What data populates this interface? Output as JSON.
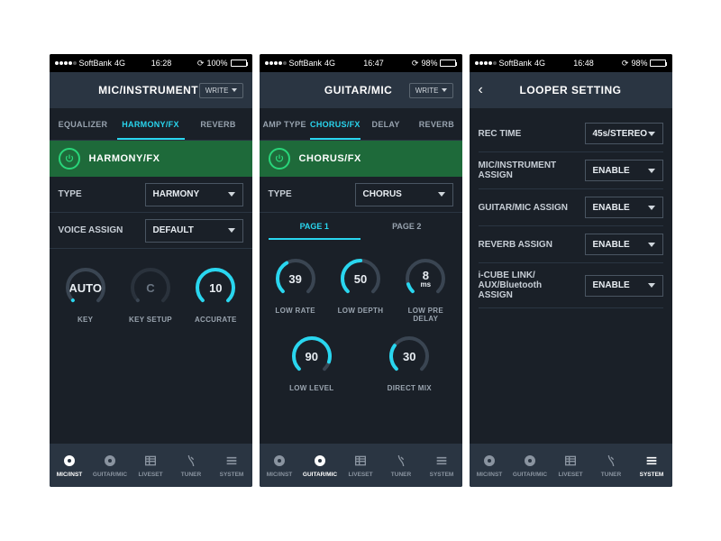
{
  "statusbar": {
    "carrier": "SoftBank",
    "network": "4G",
    "times": [
      "16:28",
      "16:47",
      "16:48"
    ],
    "batteries": [
      "100%",
      "98%",
      "98%"
    ]
  },
  "screens": [
    {
      "title": "MIC/INSTRUMENT",
      "write": "WRITE",
      "tabs": [
        "EQUALIZER",
        "HARMONY/FX",
        "REVERB"
      ],
      "activeTab": 1,
      "fxTitle": "HARMONY/FX",
      "params": [
        {
          "label": "TYPE",
          "value": "HARMONY"
        },
        {
          "label": "VOICE ASSIGN",
          "value": "DEFAULT"
        }
      ],
      "dials": [
        {
          "value": "AUTO",
          "unit": "",
          "caption": "KEY",
          "pct": 0,
          "active": true
        },
        {
          "value": "C",
          "unit": "",
          "caption": "KEY SETUP",
          "pct": 0,
          "active": false
        },
        {
          "value": "10",
          "unit": "",
          "caption": "ACCURATE",
          "pct": 100,
          "active": true
        }
      ],
      "bottomActive": 0
    },
    {
      "title": "GUITAR/MIC",
      "write": "WRITE",
      "tabs": [
        "AMP TYPE",
        "CHORUS/FX",
        "DELAY",
        "REVERB"
      ],
      "activeTab": 1,
      "fxTitle": "CHORUS/FX",
      "params": [
        {
          "label": "TYPE",
          "value": "CHORUS"
        }
      ],
      "subtabs": [
        "PAGE 1",
        "PAGE 2"
      ],
      "subtabActive": 0,
      "dials": [
        {
          "value": "39",
          "unit": "",
          "caption": "LOW RATE",
          "pct": 39,
          "active": true
        },
        {
          "value": "50",
          "unit": "",
          "caption": "LOW DEPTH",
          "pct": 50,
          "active": true
        },
        {
          "value": "8",
          "unit": "ms",
          "caption": "LOW PRE DELAY",
          "pct": 10,
          "active": true
        },
        {
          "value": "90",
          "unit": "",
          "caption": "LOW LEVEL",
          "pct": 90,
          "active": true
        },
        {
          "value": "30",
          "unit": "",
          "caption": "DIRECT MIX",
          "pct": 30,
          "active": true
        }
      ],
      "bottomActive": 1
    },
    {
      "title": "LOOPER SETTING",
      "back": true,
      "settings": [
        {
          "label": "REC TIME",
          "value": "45s/STEREO"
        },
        {
          "label": "MIC/INSTRUMENT ASSIGN",
          "value": "ENABLE"
        },
        {
          "label": "GUITAR/MIC ASSIGN",
          "value": "ENABLE"
        },
        {
          "label": "REVERB ASSIGN",
          "value": "ENABLE"
        },
        {
          "label": "i-CUBE LINK/\nAUX/Bluetooth ASSIGN",
          "value": "ENABLE"
        }
      ],
      "bottomActive": 4
    }
  ],
  "bottomnav": [
    "MIC/INST",
    "GUITAR/MIC",
    "LIVESET",
    "TUNER",
    "SYSTEM"
  ]
}
